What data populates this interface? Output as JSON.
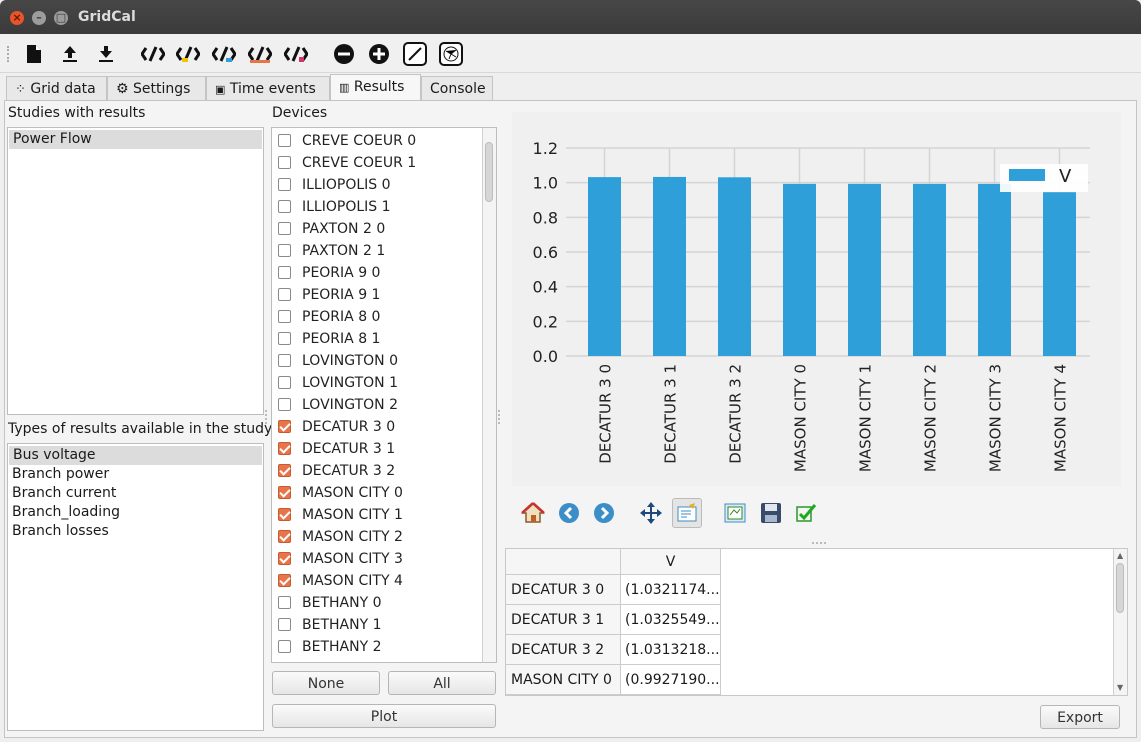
{
  "app": {
    "title": "GridCal"
  },
  "tabs": [
    {
      "label": "Grid data",
      "icon": "graph-icon"
    },
    {
      "label": "Settings",
      "icon": "gear-icon"
    },
    {
      "label": "Time events",
      "icon": "chip-icon"
    },
    {
      "label": "Results",
      "icon": "bar-chart-icon"
    },
    {
      "label": "Console"
    }
  ],
  "studies": {
    "header": "Studies with results",
    "items": [
      "Power Flow"
    ],
    "selected": "Power Flow"
  },
  "result_types": {
    "header": "Types of results available in the study",
    "items": [
      "Bus voltage",
      "Branch power",
      "Branch current",
      "Branch_loading",
      "Branch losses"
    ],
    "selected": "Bus voltage"
  },
  "devices": {
    "header": "Devices",
    "items": [
      {
        "name": "CREVE COEUR 0",
        "checked": false
      },
      {
        "name": "CREVE COEUR 1",
        "checked": false
      },
      {
        "name": "ILLIOPOLIS 0",
        "checked": false
      },
      {
        "name": "ILLIOPOLIS 1",
        "checked": false
      },
      {
        "name": "PAXTON 2 0",
        "checked": false
      },
      {
        "name": "PAXTON 2 1",
        "checked": false
      },
      {
        "name": "PEORIA 9 0",
        "checked": false
      },
      {
        "name": "PEORIA 9 1",
        "checked": false
      },
      {
        "name": "PEORIA 8 0",
        "checked": false
      },
      {
        "name": "PEORIA 8 1",
        "checked": false
      },
      {
        "name": "LOVINGTON 0",
        "checked": false
      },
      {
        "name": "LOVINGTON 1",
        "checked": false
      },
      {
        "name": "LOVINGTON 2",
        "checked": false
      },
      {
        "name": "DECATUR 3 0",
        "checked": true
      },
      {
        "name": "DECATUR 3 1",
        "checked": true
      },
      {
        "name": "DECATUR 3 2",
        "checked": true
      },
      {
        "name": "MASON CITY 0",
        "checked": true
      },
      {
        "name": "MASON CITY 1",
        "checked": true
      },
      {
        "name": "MASON CITY 2",
        "checked": true
      },
      {
        "name": "MASON CITY 3",
        "checked": true
      },
      {
        "name": "MASON CITY 4",
        "checked": true
      },
      {
        "name": "BETHANY 0",
        "checked": false
      },
      {
        "name": "BETHANY 1",
        "checked": false
      },
      {
        "name": "BETHANY 2",
        "checked": false
      }
    ],
    "none_label": "None",
    "all_label": "All",
    "plot_label": "Plot"
  },
  "chart_data": {
    "type": "bar",
    "categories": [
      "DECATUR 3 0",
      "DECATUR 3 1",
      "DECATUR 3 2",
      "MASON CITY 0",
      "MASON CITY 1",
      "MASON CITY 2",
      "MASON CITY 3",
      "MASON CITY 4"
    ],
    "series": [
      {
        "name": "V",
        "values": [
          1.032,
          1.033,
          1.031,
          0.993,
          0.993,
          0.993,
          0.993,
          0.945
        ]
      }
    ],
    "ylim": [
      0,
      1.2
    ],
    "yticks": [
      "0.0",
      "0.2",
      "0.4",
      "0.6",
      "0.8",
      "1.0",
      "1.2"
    ],
    "grid": true,
    "legend": "top-right",
    "bar_color": "#2e9fd8"
  },
  "plot_toolbar": [
    "home-icon",
    "back-icon",
    "forward-icon",
    "pan-icon",
    "edit-axis-icon",
    "configure-subplots-icon",
    "save-icon",
    "check-icon"
  ],
  "table": {
    "column": "V",
    "rows": [
      {
        "label": "DECATUR 3 0",
        "value": "(1.0321174..."
      },
      {
        "label": "DECATUR 3 1",
        "value": "(1.0325549..."
      },
      {
        "label": "DECATUR 3 2",
        "value": "(1.0313218..."
      },
      {
        "label": "MASON CITY 0",
        "value": "(0.9927190..."
      }
    ]
  },
  "export_label": "Export"
}
